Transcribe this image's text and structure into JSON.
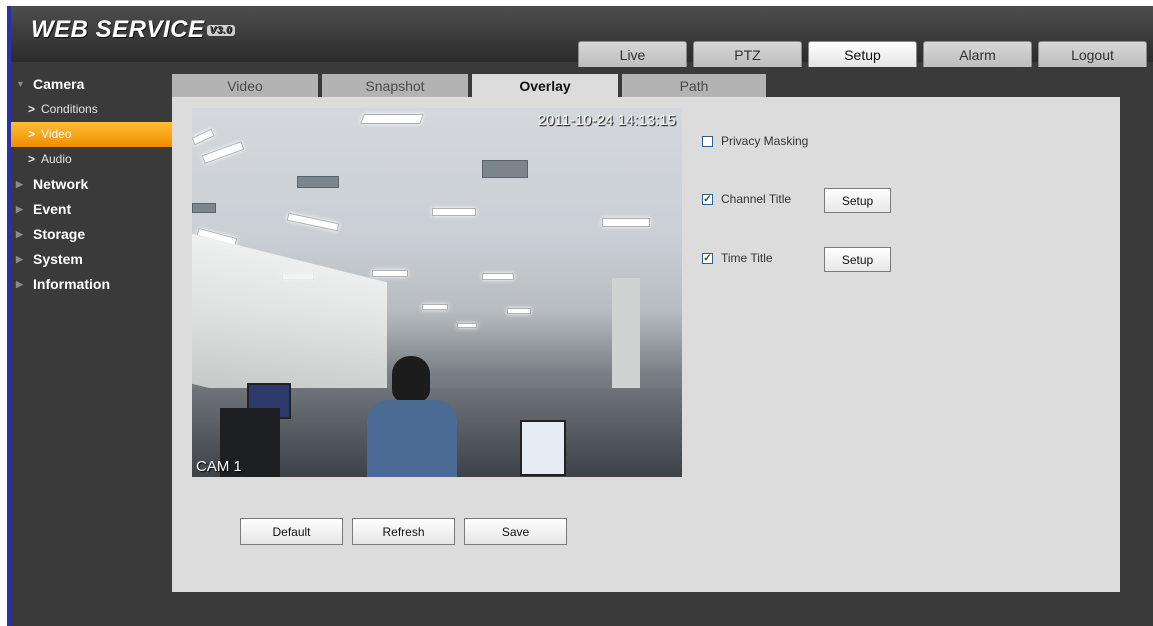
{
  "app": {
    "logo_text": "WEB SERVICE",
    "logo_version": "V3.0"
  },
  "main_tabs": [
    {
      "label": "Live",
      "active": false
    },
    {
      "label": "PTZ",
      "active": false
    },
    {
      "label": "Setup",
      "active": true
    },
    {
      "label": "Alarm",
      "active": false
    },
    {
      "label": "Logout",
      "active": false
    }
  ],
  "sidebar": {
    "camera": {
      "label": "Camera",
      "items": [
        {
          "label": "Conditions",
          "active": false
        },
        {
          "label": "Video",
          "active": true
        },
        {
          "label": "Audio",
          "active": false
        }
      ]
    },
    "categories": [
      "Network",
      "Event",
      "Storage",
      "System",
      "Information"
    ]
  },
  "sub_tabs": [
    {
      "label": "Video",
      "active": false
    },
    {
      "label": "Snapshot",
      "active": false
    },
    {
      "label": "Overlay",
      "active": true
    },
    {
      "label": "Path",
      "active": false
    }
  ],
  "video": {
    "timestamp": "2011-10-24 14:13:15",
    "camera_label": "CAM 1"
  },
  "overlay_options": [
    {
      "label": "Privacy Masking",
      "checked": false,
      "setup_label": ""
    },
    {
      "label": "Channel Title",
      "checked": true,
      "setup_label": "Setup"
    },
    {
      "label": "Time Title",
      "checked": true,
      "setup_label": "Setup"
    }
  ],
  "actions": {
    "default_label": "Default",
    "refresh_label": "Refresh",
    "save_label": "Save"
  },
  "colors": {
    "active_sidebar": "#f5a000",
    "frame_bg": "#3a3a3a",
    "panel_bg": "#dcdcdc"
  }
}
